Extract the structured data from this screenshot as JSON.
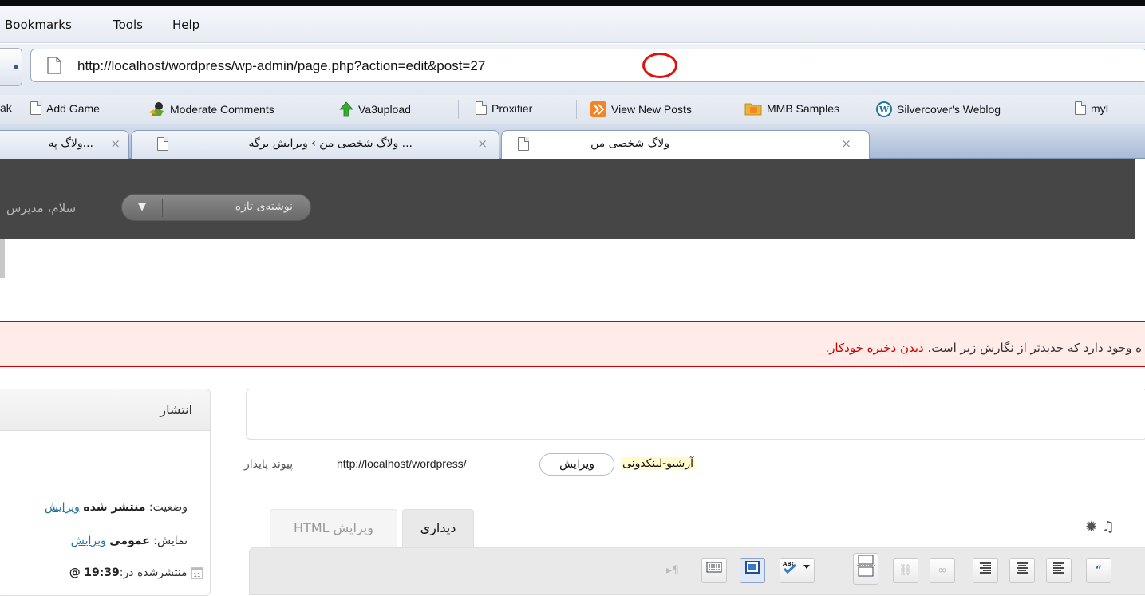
{
  "menubar": {
    "items": [
      "Bookmarks",
      "Tools",
      "Help"
    ]
  },
  "navbar": {
    "url": "http://localhost/wordpress/wp-admin/page.php?action=edit&post=27"
  },
  "bookmarks": {
    "items": [
      {
        "label": "ak",
        "icon": "partial"
      },
      {
        "label": "Add Game",
        "icon": "page-icon"
      },
      {
        "label": "Moderate Comments",
        "icon": "user-comment-icon"
      },
      {
        "label": "Va3upload",
        "icon": "green-up-arrow-icon"
      },
      {
        "label": "Proxifier",
        "icon": "page-icon"
      },
      {
        "label": "View New Posts",
        "icon": "rss-feed-icon"
      },
      {
        "label": "MMB Samples",
        "icon": "rss-folder-icon"
      },
      {
        "label": "Silvercover's Weblog",
        "icon": "wordpress-icon"
      },
      {
        "label": "myL",
        "icon": "page-icon"
      }
    ]
  },
  "tabs": [
    {
      "title": "...ولاگ په",
      "active": false
    },
    {
      "title": "... ولاگ شخصی من › ویرایش برگه",
      "active": false
    },
    {
      "title": "ولاگ شخصی من",
      "active": true
    }
  ],
  "adminbar": {
    "new_post_label": "نوشته‌ی تازه",
    "howdy": "سلام، مدیرس"
  },
  "notice": {
    "text": "ه وجود دارد که جدیدتر از نگارش زیر است. ",
    "link": "دیدن ذخیره خودکار",
    "suffix": "."
  },
  "publish": {
    "title": "انتشار",
    "status_label": "وضعیت:",
    "status_value": "منتشر شده",
    "status_edit": "ویرایش",
    "visibility_label": "نمایش:",
    "visibility_value": "عمومی",
    "visibility_edit": "ویرایش",
    "published_label": "منتشرشده در:",
    "published_time": "19:39",
    "published_at": "@"
  },
  "permalink": {
    "label": "پیوند پایدار",
    "url": "http://localhost/wordpress/",
    "edit_button": "ویرایش",
    "slug": "آرشیو-لینکدونی"
  },
  "editor": {
    "tab_visual": "دیداری",
    "tab_html": "ویرایش HTML",
    "media_icons": "✹   ♫"
  },
  "colors": {
    "adminbar": "#464646",
    "notice_bg": "#ffebe8",
    "notice_border": "#cc0000",
    "link": "#21759b",
    "url_highlight": "#e31010"
  }
}
